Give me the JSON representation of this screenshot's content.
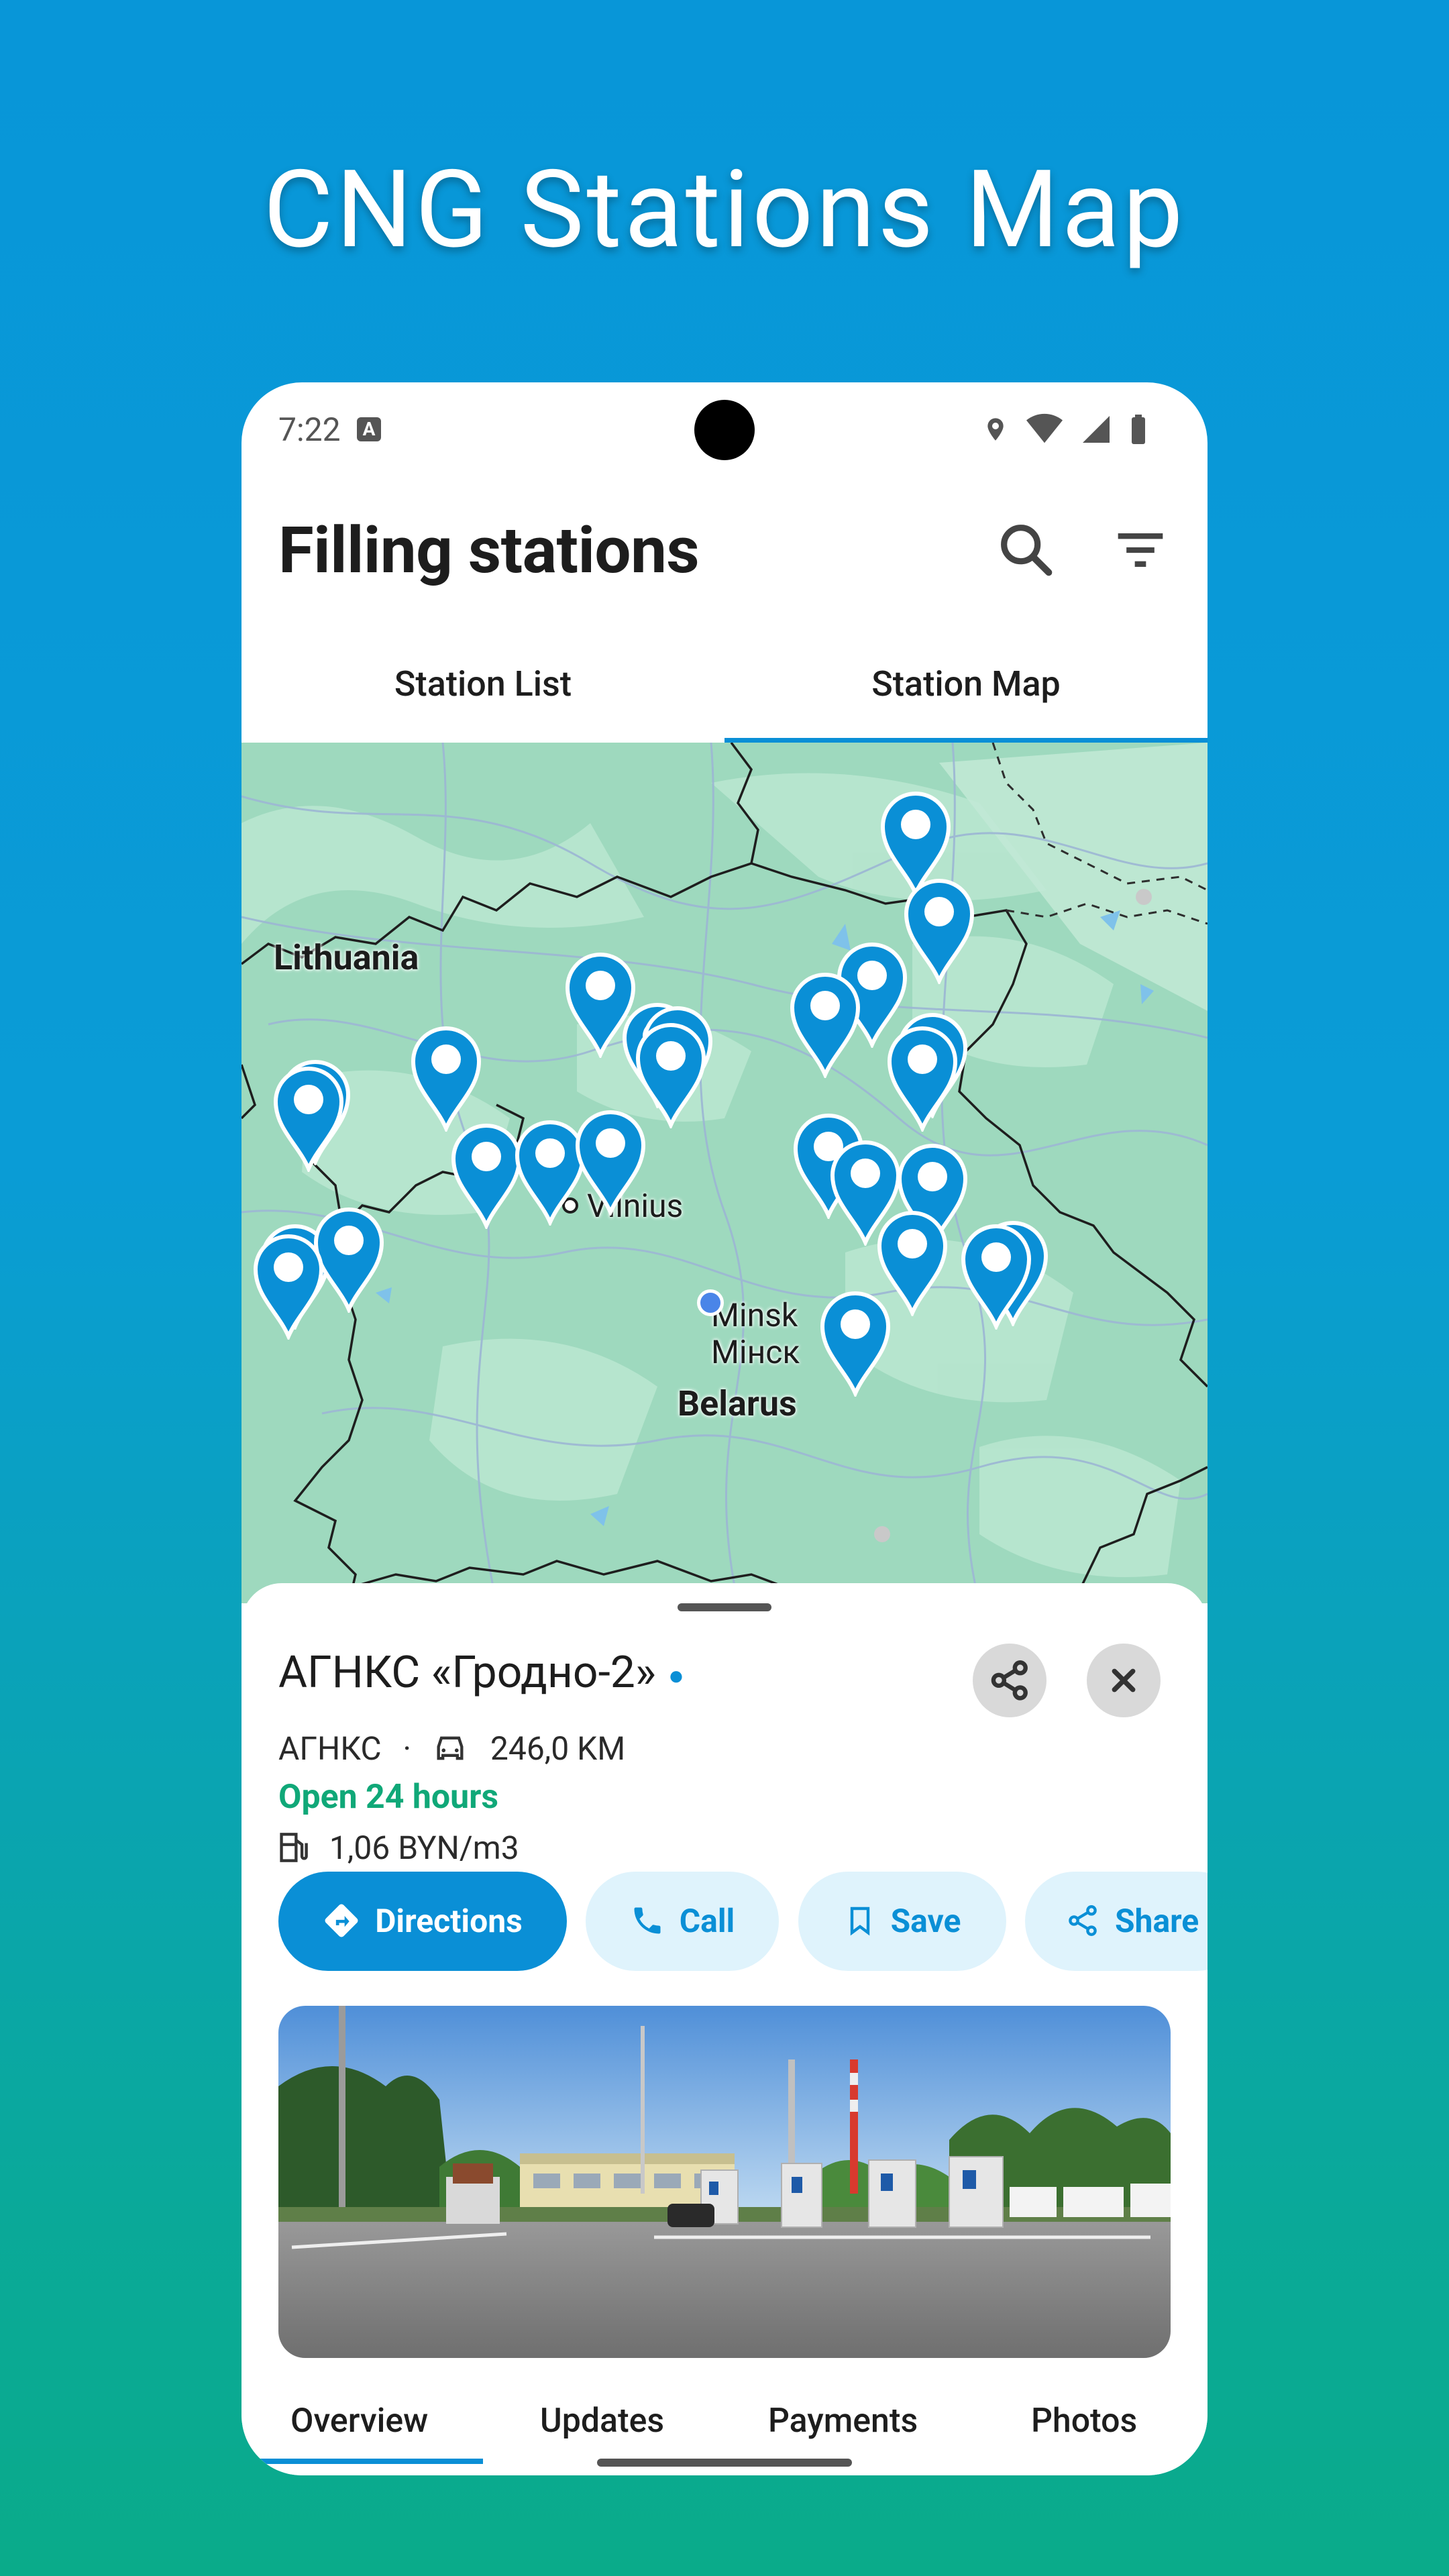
{
  "promo": {
    "title": "CNG Stations Map"
  },
  "status_bar": {
    "time": "7:22",
    "notif_icon_letter": "A"
  },
  "app_bar": {
    "title": "Filling stations",
    "search_icon": "search-icon",
    "filter_icon": "filter-icon"
  },
  "tabs": [
    {
      "label": "Station List"
    },
    {
      "label": "Station Map"
    }
  ],
  "active_tab": "Station Map",
  "map": {
    "labels": {
      "lithuania": "Lithuania",
      "vilnius": "Vilnius",
      "minsk": "Minsk",
      "minsk_local": "Мінск",
      "belarus": "Belarus"
    },
    "pin_color": "#0a8fd6",
    "land_color": "#9ed9be"
  },
  "station": {
    "name": "АГНКС «Гродно-2»",
    "type": "АГНКС",
    "distance": "246,0 KM",
    "hours": "Open 24 hours",
    "price": "1,06 BYN/m3"
  },
  "actions": {
    "directions": "Directions",
    "call": "Call",
    "save": "Save",
    "share": "Share"
  },
  "bottom_tabs": [
    {
      "label": "Overview"
    },
    {
      "label": "Updates"
    },
    {
      "label": "Payments"
    },
    {
      "label": "Photos"
    }
  ],
  "colors": {
    "accent": "#0a8fd6",
    "open_green": "#10a878"
  }
}
